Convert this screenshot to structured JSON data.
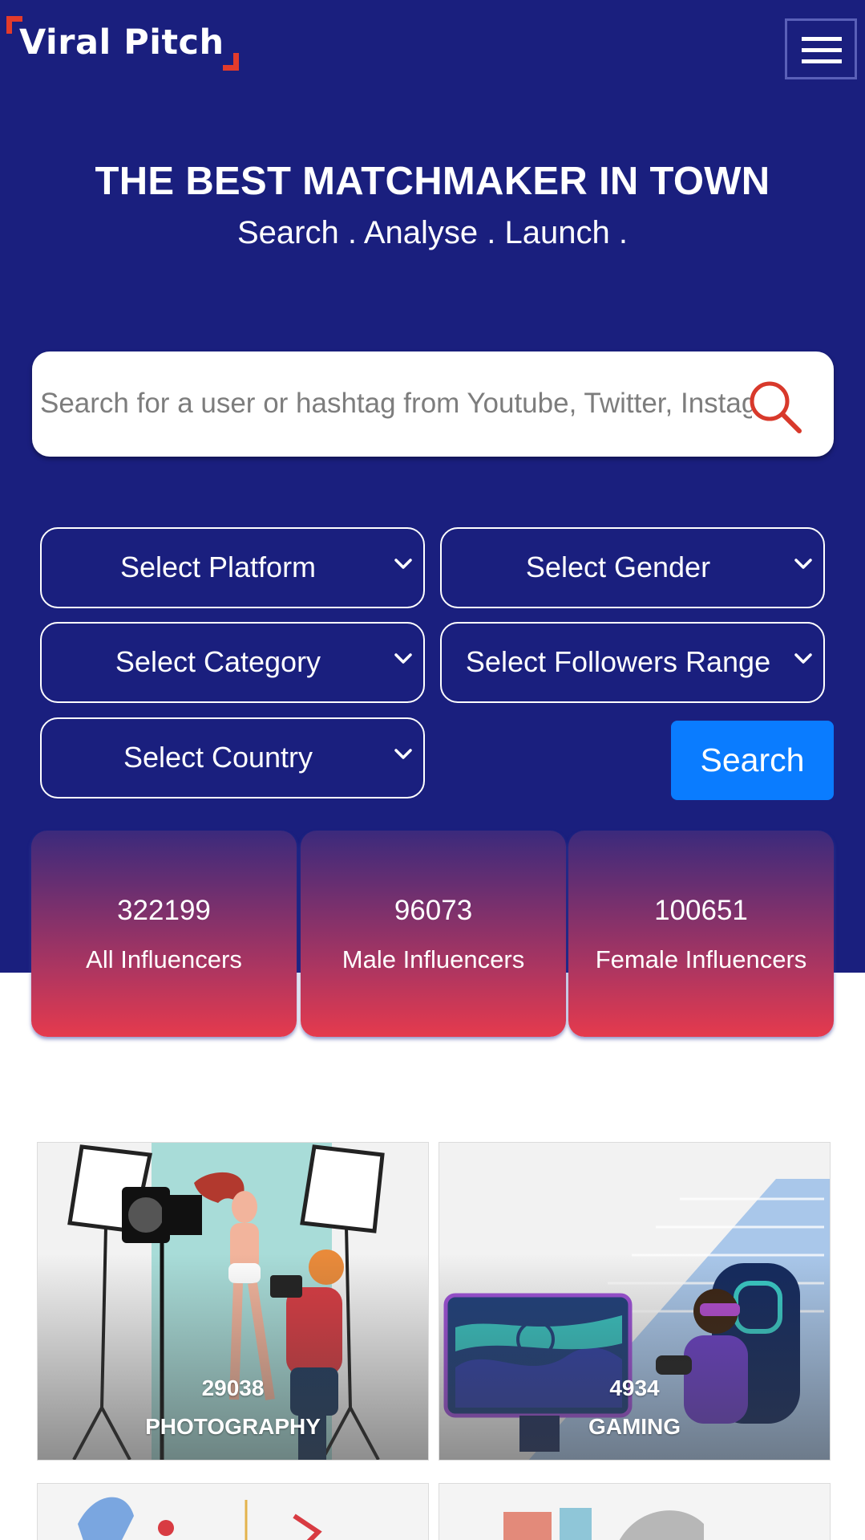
{
  "brand": {
    "name": "Viral Pitch",
    "accent": "#e33b2b",
    "navy": "#1a1f7e",
    "button_blue": "#0a7cff"
  },
  "header": {
    "menu_icon": "hamburger-icon"
  },
  "hero": {
    "headline": "THE BEST MATCHMAKER IN TOWN",
    "tagline": "Search . Analyse . Launch ."
  },
  "search": {
    "placeholder": "Search for a user or hashtag from Youtube, Twitter, Instagram",
    "icon": "search-icon"
  },
  "filters": {
    "platform": "Select Platform",
    "gender": "Select Gender",
    "category": "Select Category",
    "followers": "Select Followers Range",
    "country": "Select Country",
    "search_button": "Search"
  },
  "stats": [
    {
      "count": "322199",
      "label": "All Influencers"
    },
    {
      "count": "96073",
      "label": "Male Influencers"
    },
    {
      "count": "100651",
      "label": "Female Influencers"
    }
  ],
  "categories": [
    {
      "count": "29038",
      "name": "PHOTOGRAPHY"
    },
    {
      "count": "4934",
      "name": "GAMING"
    }
  ]
}
